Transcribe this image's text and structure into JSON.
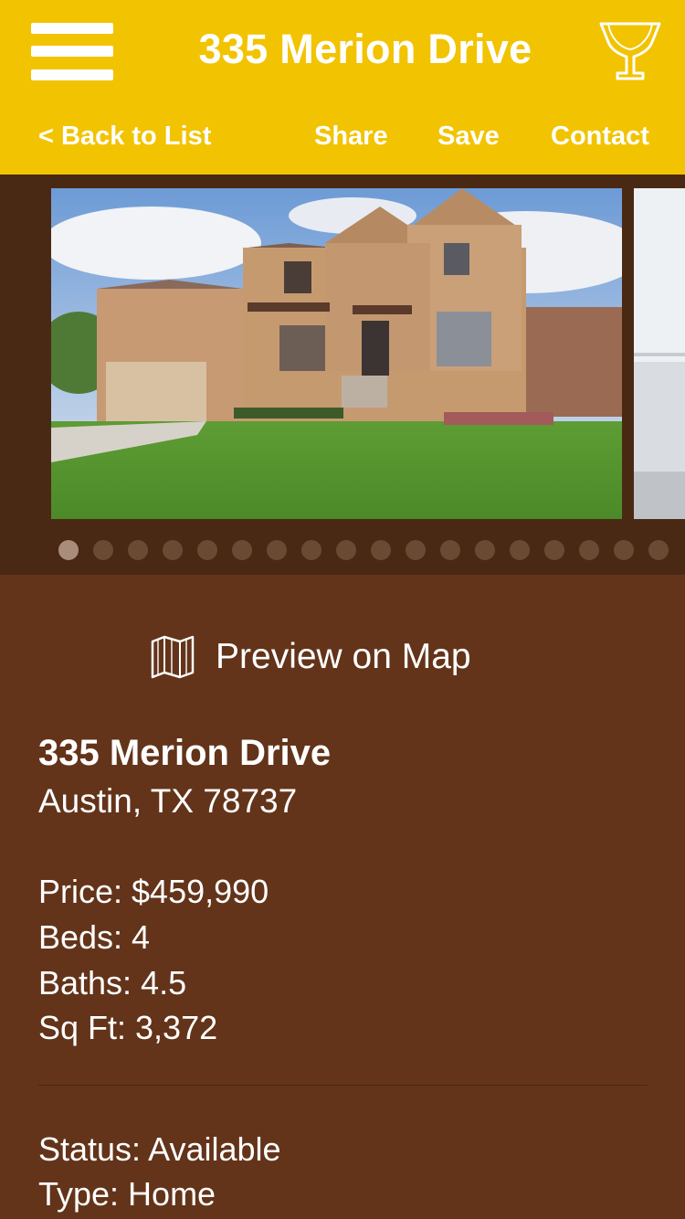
{
  "header": {
    "title": "335 Merion Drive",
    "menu_icon": "hamburger-menu-icon",
    "trophy_icon": "trophy-icon",
    "nav": {
      "back": "< Back to List",
      "share": "Share",
      "save": "Save",
      "contact": "Contact"
    }
  },
  "gallery": {
    "photo_count": 18,
    "active_index": 0
  },
  "map": {
    "icon": "map-icon",
    "label": "Preview on Map"
  },
  "listing": {
    "address": "335 Merion Drive",
    "city": "Austin, TX 78737",
    "price": "Price: $459,990",
    "beds": "Beds: 4",
    "baths": "Baths: 4.5",
    "sqft": "Sq Ft: 3,372",
    "status": "Status: Available",
    "type": "Type: Home"
  },
  "colors": {
    "header_bg": "#f2c300",
    "body_bg": "#63341a",
    "gallery_bg": "#4a2914"
  }
}
